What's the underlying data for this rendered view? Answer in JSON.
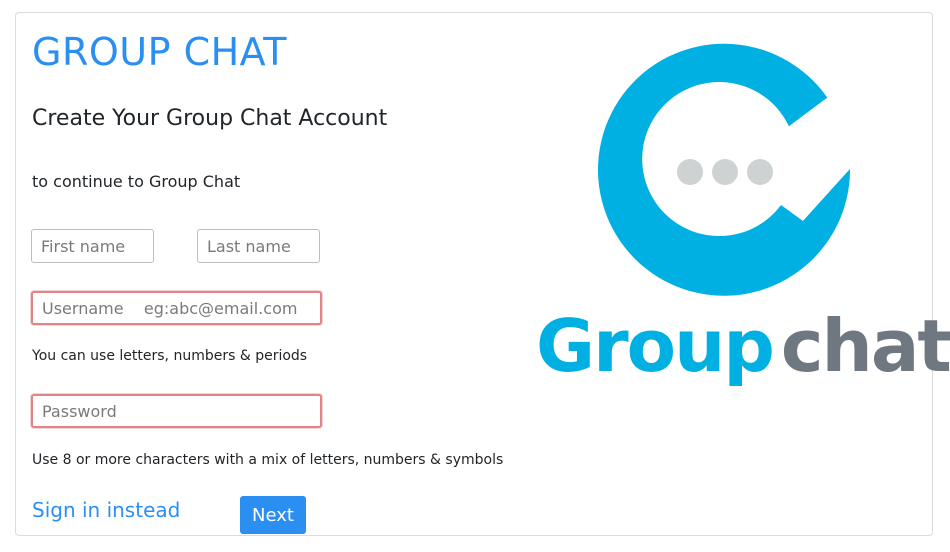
{
  "app": {
    "brand": "GROUP CHAT",
    "heading": "Create Your Group Chat Account",
    "subtitle": "to continue to Group Chat"
  },
  "form": {
    "first_name_placeholder": "First name",
    "last_name_placeholder": "Last name",
    "username_placeholder": "Username    eg:abc@email.com",
    "username_hint": "You can use letters, numbers & periods",
    "password_placeholder": "Password",
    "password_hint": "Use 8 or more characters with a mix of letters, numbers & symbols",
    "sign_in_label": "Sign in instead",
    "next_label": "Next"
  },
  "logo": {
    "word_primary": "Group",
    "word_secondary": "chat",
    "colors": {
      "primary": "#00b0e2",
      "secondary": "#6f7780",
      "dots": "#cfd2d3"
    },
    "icon": "chat-bubble-g-logo"
  },
  "colors": {
    "accent": "#2b8ff2",
    "invalid_border": "#e08585"
  }
}
